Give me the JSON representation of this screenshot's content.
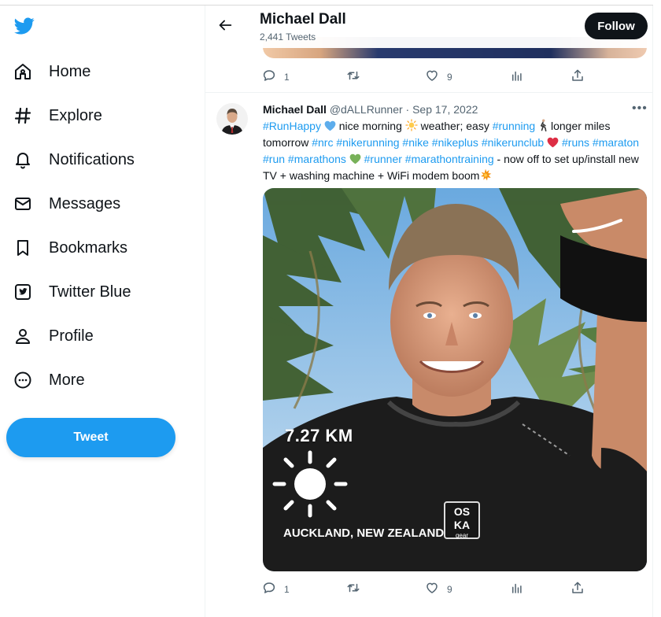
{
  "sidebar": {
    "items": [
      {
        "label": "Home",
        "icon": "home-icon"
      },
      {
        "label": "Explore",
        "icon": "hashtag-icon"
      },
      {
        "label": "Notifications",
        "icon": "bell-icon"
      },
      {
        "label": "Messages",
        "icon": "envelope-icon"
      },
      {
        "label": "Bookmarks",
        "icon": "bookmark-icon"
      },
      {
        "label": "Twitter Blue",
        "icon": "twitter-blue-icon"
      },
      {
        "label": "Profile",
        "icon": "profile-icon"
      },
      {
        "label": "More",
        "icon": "more-circle-icon"
      }
    ],
    "tweet_button": "Tweet"
  },
  "header": {
    "name": "Michael Dall",
    "tweet_count": "2,441 Tweets",
    "follow_label": "Follow"
  },
  "prev_tweet_actions": {
    "replies": "1",
    "likes": "9"
  },
  "tweet": {
    "name": "Michael Dall",
    "handle": "@dALLRunner",
    "separator": "·",
    "date": "Sep 17, 2022",
    "text": {
      "t1": "#RunHappy",
      "t2": " nice morning ",
      "t3": " weather; easy ",
      "t4": "#running",
      "t5": " longer miles tomorrow ",
      "t6": "#nrc",
      "t7": "#nikerunning",
      "t8": "#nike",
      "t9": "#nikeplus",
      "t10": "#nikerunclub",
      "t11": "#runs",
      "t12": "#maraton",
      "t13": "#run",
      "t14": "#marathons",
      "t15": "#runner",
      "t16": "#marathontraining",
      "t17": " - now off to set up/install new TV + washing machine + WiFi modem boom"
    },
    "media": {
      "distance": "7.27 KM",
      "location": "AUCKLAND, NEW ZEALAND",
      "shirt_logo_line1": "OS",
      "shirt_logo_line2": "KA",
      "shirt_logo_line3": "gear"
    },
    "actions": {
      "replies": "1",
      "likes": "9"
    }
  },
  "colors": {
    "accent": "#1d9bf0",
    "text": "#0f1419",
    "muted": "#536471",
    "follow_bg": "#0f1419"
  }
}
